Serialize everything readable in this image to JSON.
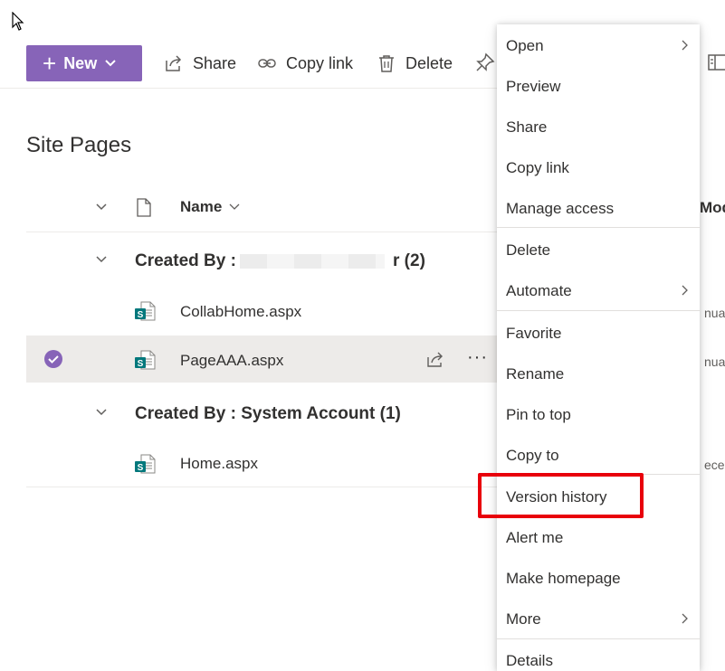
{
  "toolbar": {
    "new_label": "New",
    "share_label": "Share",
    "copy_link_label": "Copy link",
    "delete_label": "Delete"
  },
  "page_title": "Site Pages",
  "header": {
    "name_label": "Name",
    "modified_partial": "Modi"
  },
  "groups": [
    {
      "label": "Created By : ",
      "suffix": "r (2)",
      "files": [
        {
          "name": "CollabHome.aspx",
          "modified_partial": "nuar"
        },
        {
          "name": "PageAAA.aspx",
          "modified_partial": "nuar"
        }
      ]
    },
    {
      "label": "Created By : System Account (1)",
      "files": [
        {
          "name": "Home.aspx",
          "modified_partial": "ecen"
        }
      ]
    }
  ],
  "menu": {
    "items": [
      {
        "label": "Open",
        "submenu": true
      },
      {
        "label": "Preview"
      },
      {
        "label": "Share"
      },
      {
        "label": "Copy link"
      },
      {
        "label": "Manage access"
      },
      {
        "label": "Delete"
      },
      {
        "label": "Automate",
        "submenu": true
      },
      {
        "label": "Favorite"
      },
      {
        "label": "Rename"
      },
      {
        "label": "Pin to top"
      },
      {
        "label": "Copy to"
      },
      {
        "label": "Version history"
      },
      {
        "label": "Alert me"
      },
      {
        "label": "Make homepage"
      },
      {
        "label": "More",
        "submenu": true
      },
      {
        "label": "Details"
      }
    ]
  },
  "colors": {
    "accent": "#8764b8",
    "highlight": "#e8000b",
    "selected_row": "#edebe9",
    "sharepoint_icon": "#03787c"
  }
}
